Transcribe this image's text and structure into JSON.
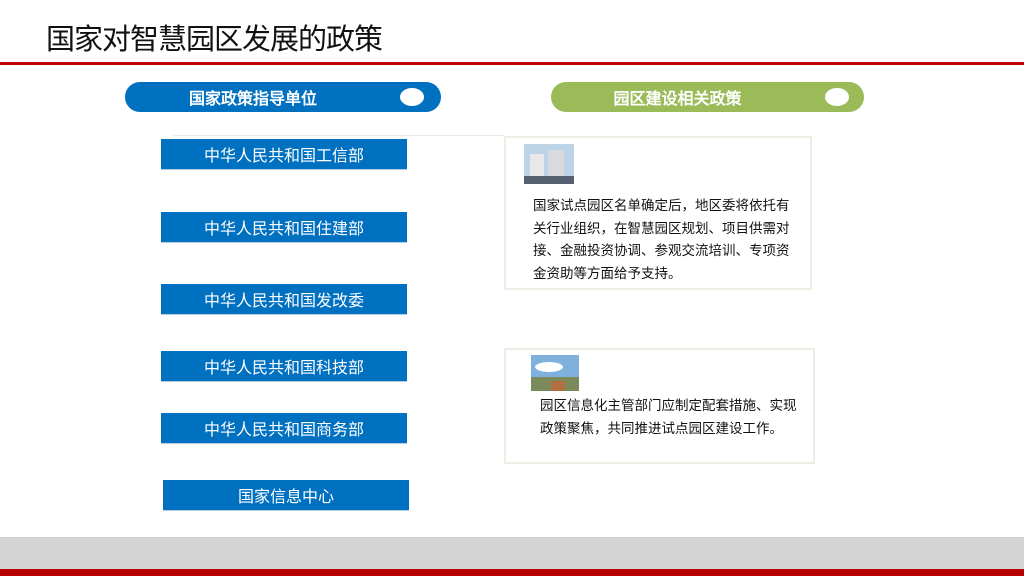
{
  "title": "国家对智慧园区发展的政策",
  "left_header": "国家政策指导单位",
  "right_header": "园区建设相关政策",
  "organizations": [
    "中华人民共和国工信部",
    "中华人民共和国住建部",
    "中华人民共和国发改委",
    "中华人民共和国科技部",
    "中华人民共和国商务部",
    "国家信息中心"
  ],
  "policies": [
    {
      "text": "国家试点园区名单确定后，地区委将依托有关行业组织，在智慧园区规划、项目供需对接、金融投资协调、参观交流培训、专项资金资助等方面给予支持。"
    },
    {
      "text": "园区信息化主管部门应制定配套措施、实现政策聚焦，共同推进试点园区建设工作。"
    }
  ],
  "colors": {
    "blue": "#0070c0",
    "green": "#9bbb59",
    "red": "#c00000"
  }
}
